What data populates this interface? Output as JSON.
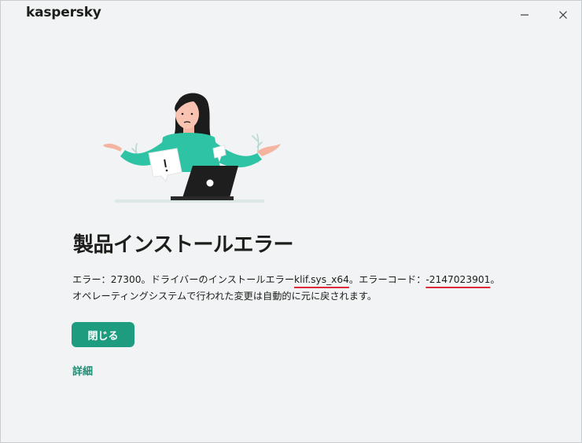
{
  "window": {
    "app_logo": "kaspersky"
  },
  "main": {
    "heading": "製品インストールエラー",
    "message": {
      "line1_prefix": "エラー：27300。ドライバーのインストールエラー",
      "driver_name": "klif.sys_x64",
      "line1_middle": "。エラーコード：",
      "error_code": "-2147023901",
      "line1_suffix": "。",
      "line2": "オペレーティングシステムで行われた変更は自動的に元に戻されます。"
    },
    "close_button_label": "閉じる",
    "details_link_label": "詳細"
  },
  "colors": {
    "accent": "#1e9c80",
    "link": "#1e8c74",
    "highlight_underline": "#e0283c",
    "background": "#f1f3f4"
  },
  "icons": {
    "minimize": "minimize-icon",
    "close": "close-window-icon"
  }
}
